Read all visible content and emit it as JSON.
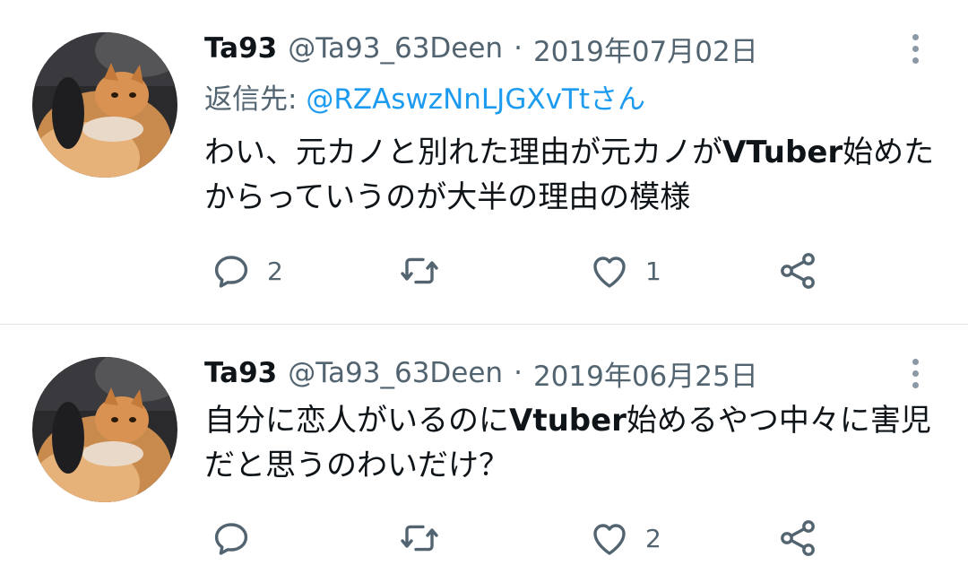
{
  "tweets": [
    {
      "display_name": "Ta93",
      "handle": "@Ta93_63Deen",
      "separator": "·",
      "date": "2019年07月02日",
      "reply_prefix": "返信先: ",
      "reply_to": "@RZAswzNnLJGXvTtさん",
      "text_before": "わい、元カノと別れた理由が元カノが",
      "text_bold": "VTuber",
      "text_after": "始めたからっていうのが大半の理由の模様",
      "reply_count": "2",
      "retweet_count": "",
      "like_count": "1"
    },
    {
      "display_name": "Ta93",
      "handle": "@Ta93_63Deen",
      "separator": "·",
      "date": "2019年06月25日",
      "text_before": "自分に恋人がいるのに",
      "text_bold": "Vtuber",
      "text_after": "始めるやつ中々に害児だと思うのわいだけ？",
      "reply_count": "",
      "retweet_count": "",
      "like_count": "2"
    }
  ],
  "colors": {
    "text": "#0f1419",
    "secondary": "#536471",
    "link": "#1d9bf0",
    "divider": "#e1e6ea"
  },
  "icons": [
    "reply-icon",
    "retweet-icon",
    "like-icon",
    "share-icon",
    "more-icon"
  ]
}
